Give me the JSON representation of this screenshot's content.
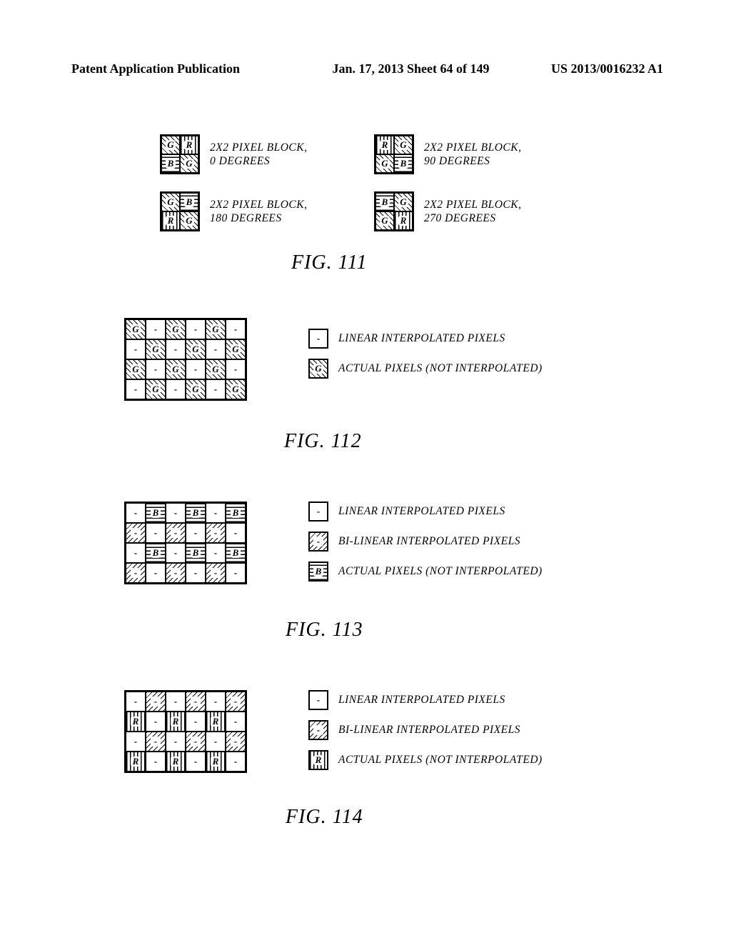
{
  "header": {
    "left": "Patent Application Publication",
    "center": "Jan. 17, 2013  Sheet 64 of 149",
    "right": "US 2013/0016232 A1"
  },
  "letters": {
    "G": "G",
    "R": "R",
    "B": "B",
    "dash": "-"
  },
  "fig111": {
    "label": "FIG. 111",
    "c0a": "2X2 PIXEL BLOCK,",
    "c0b": "0 DEGREES",
    "c90a": "2X2 PIXEL BLOCK,",
    "c90b": "90 DEGREES",
    "c180a": "2X2 PIXEL BLOCK,",
    "c180b": "180 DEGREES",
    "c270a": "2X2 PIXEL BLOCK,",
    "c270b": "270 DEGREES"
  },
  "fig112": {
    "label": "FIG. 112",
    "grid": [
      [
        "G",
        "-",
        "G",
        "-",
        "G",
        "-"
      ],
      [
        "-",
        "G",
        "-",
        "G",
        "-",
        "G"
      ],
      [
        "G",
        "-",
        "G",
        "-",
        "G",
        "-"
      ],
      [
        "-",
        "G",
        "-",
        "G",
        "-",
        "G"
      ]
    ],
    "hatch": {
      "G": "diag",
      "-": "blank"
    }
  },
  "fig113": {
    "label": "FIG. 113",
    "grid": [
      [
        "-",
        "B",
        "-",
        "B",
        "-",
        "B"
      ],
      [
        "~",
        "-",
        "~",
        "-",
        "~",
        "-"
      ],
      [
        "-",
        "B",
        "-",
        "B",
        "-",
        "B"
      ],
      [
        "~",
        "-",
        "~",
        "-",
        "~",
        "-"
      ]
    ],
    "hatch": {
      "B": "horiz",
      "-": "blank",
      "~": "slash"
    }
  },
  "fig114": {
    "label": "FIG. 114",
    "grid": [
      [
        "-",
        "~",
        "-",
        "~",
        "-",
        "~"
      ],
      [
        "R",
        "-",
        "R",
        "-",
        "R",
        "-"
      ],
      [
        "-",
        "~",
        "-",
        "~",
        "-",
        "~"
      ],
      [
        "R",
        "-",
        "R",
        "-",
        "R",
        "-"
      ]
    ],
    "hatch": {
      "R": "vert",
      "-": "blank",
      "~": "slash"
    }
  },
  "legend": {
    "linear": "LINEAR INTERPOLATED PIXELS",
    "bilinear": "BI-LINEAR INTERPOLATED PIXELS",
    "actual": "ACTUAL PIXELS (NOT INTERPOLATED)"
  },
  "chart_data": {
    "type": "table",
    "title": "Bayer pattern 2×2 pixel blocks and interpolation maps",
    "blocks_2x2": {
      "0_degrees": [
        [
          "G",
          "R"
        ],
        [
          "B",
          "G"
        ]
      ],
      "90_degrees": [
        [
          "R",
          "G"
        ],
        [
          "G",
          "B"
        ]
      ],
      "180_degrees": [
        [
          "G",
          "B"
        ],
        [
          "R",
          "G"
        ]
      ],
      "270_degrees": [
        [
          "B",
          "G"
        ],
        [
          "G",
          "R"
        ]
      ]
    },
    "fig112_green_plane_6x4": [
      [
        "G",
        "-",
        "G",
        "-",
        "G",
        "-"
      ],
      [
        "-",
        "G",
        "-",
        "G",
        "-",
        "G"
      ],
      [
        "G",
        "-",
        "G",
        "-",
        "G",
        "-"
      ],
      [
        "-",
        "G",
        "-",
        "G",
        "-",
        "G"
      ]
    ],
    "fig113_blue_plane_6x4": [
      [
        "-",
        "B",
        "-",
        "B",
        "-",
        "B"
      ],
      [
        "bi",
        "-",
        "bi",
        "-",
        "bi",
        "-"
      ],
      [
        "-",
        "B",
        "-",
        "B",
        "-",
        "B"
      ],
      [
        "bi",
        "-",
        "bi",
        "-",
        "bi",
        "-"
      ]
    ],
    "fig114_red_plane_6x4": [
      [
        "-",
        "bi",
        "-",
        "bi",
        "-",
        "bi"
      ],
      [
        "R",
        "-",
        "R",
        "-",
        "R",
        "-"
      ],
      [
        "-",
        "bi",
        "-",
        "bi",
        "-",
        "bi"
      ],
      [
        "R",
        "-",
        "R",
        "-",
        "R",
        "-"
      ]
    ],
    "legend_codes": {
      "-": "linear interpolated pixel",
      "bi": "bi-linear interpolated pixel",
      "G": "actual green pixel",
      "B": "actual blue pixel",
      "R": "actual red pixel"
    }
  }
}
